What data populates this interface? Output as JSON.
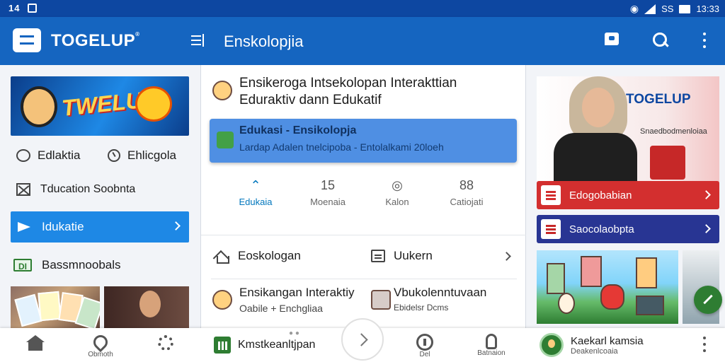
{
  "status_bar": {
    "left_text": "14",
    "right_text": "SS",
    "time": "13:33"
  },
  "app_bar": {
    "brand": "TOGELUP",
    "brand_mark": "®",
    "title": "Enskolopjia"
  },
  "left_panel": {
    "items": [
      {
        "label": "Edlaktia"
      },
      {
        "label": "Ehlicgola"
      },
      {
        "label": "Tducation Soobnta"
      },
      {
        "label": "Idukatie"
      },
      {
        "badge": "DI",
        "label": "Bassmnoobals"
      }
    ]
  },
  "center_panel": {
    "heading_line1": "Ensikeroga Intsekolopan Interakttian",
    "heading_line2": "Eduraktiv dann Edukatif",
    "highlight_title": "Edukasi - Ensikolopja",
    "highlight_subtitle": "Lardap Adalen tnelcipoba - Entolalkami 20loeh",
    "tabs": [
      {
        "icon": "⌃",
        "label": "Edukaia",
        "active": true
      },
      {
        "icon": "15",
        "label": "Moenaia",
        "active": false
      },
      {
        "icon": "◎",
        "label": "Kalon",
        "active": false
      },
      {
        "icon": "88",
        "label": "Catiojati",
        "active": false
      }
    ],
    "row_left": "Eoskologan",
    "row_right": "Uukern",
    "item1_title": "Ensikangan Interaktiy",
    "item1_sub": "Oabile + Enchgliaa",
    "item2_title": "Vbukolenntuvaan",
    "item2_sub": "Ebidelsr Dcms"
  },
  "right_panel": {
    "promo_logo": "TOGELUP",
    "promo_caption": "Snaedbodmenloiaa",
    "button_red": "Edogobabian",
    "button_blue": "Saocolaobpta"
  },
  "bottom_nav": {
    "item1_label": "Obmoth",
    "item_green_label": "Kmstkeanltjpan",
    "item_compass_label": "Del",
    "item_bell_label": "Batnaion",
    "profile_name": "Kaekarl kamsia",
    "profile_sub": "Deakenlcoaia"
  }
}
